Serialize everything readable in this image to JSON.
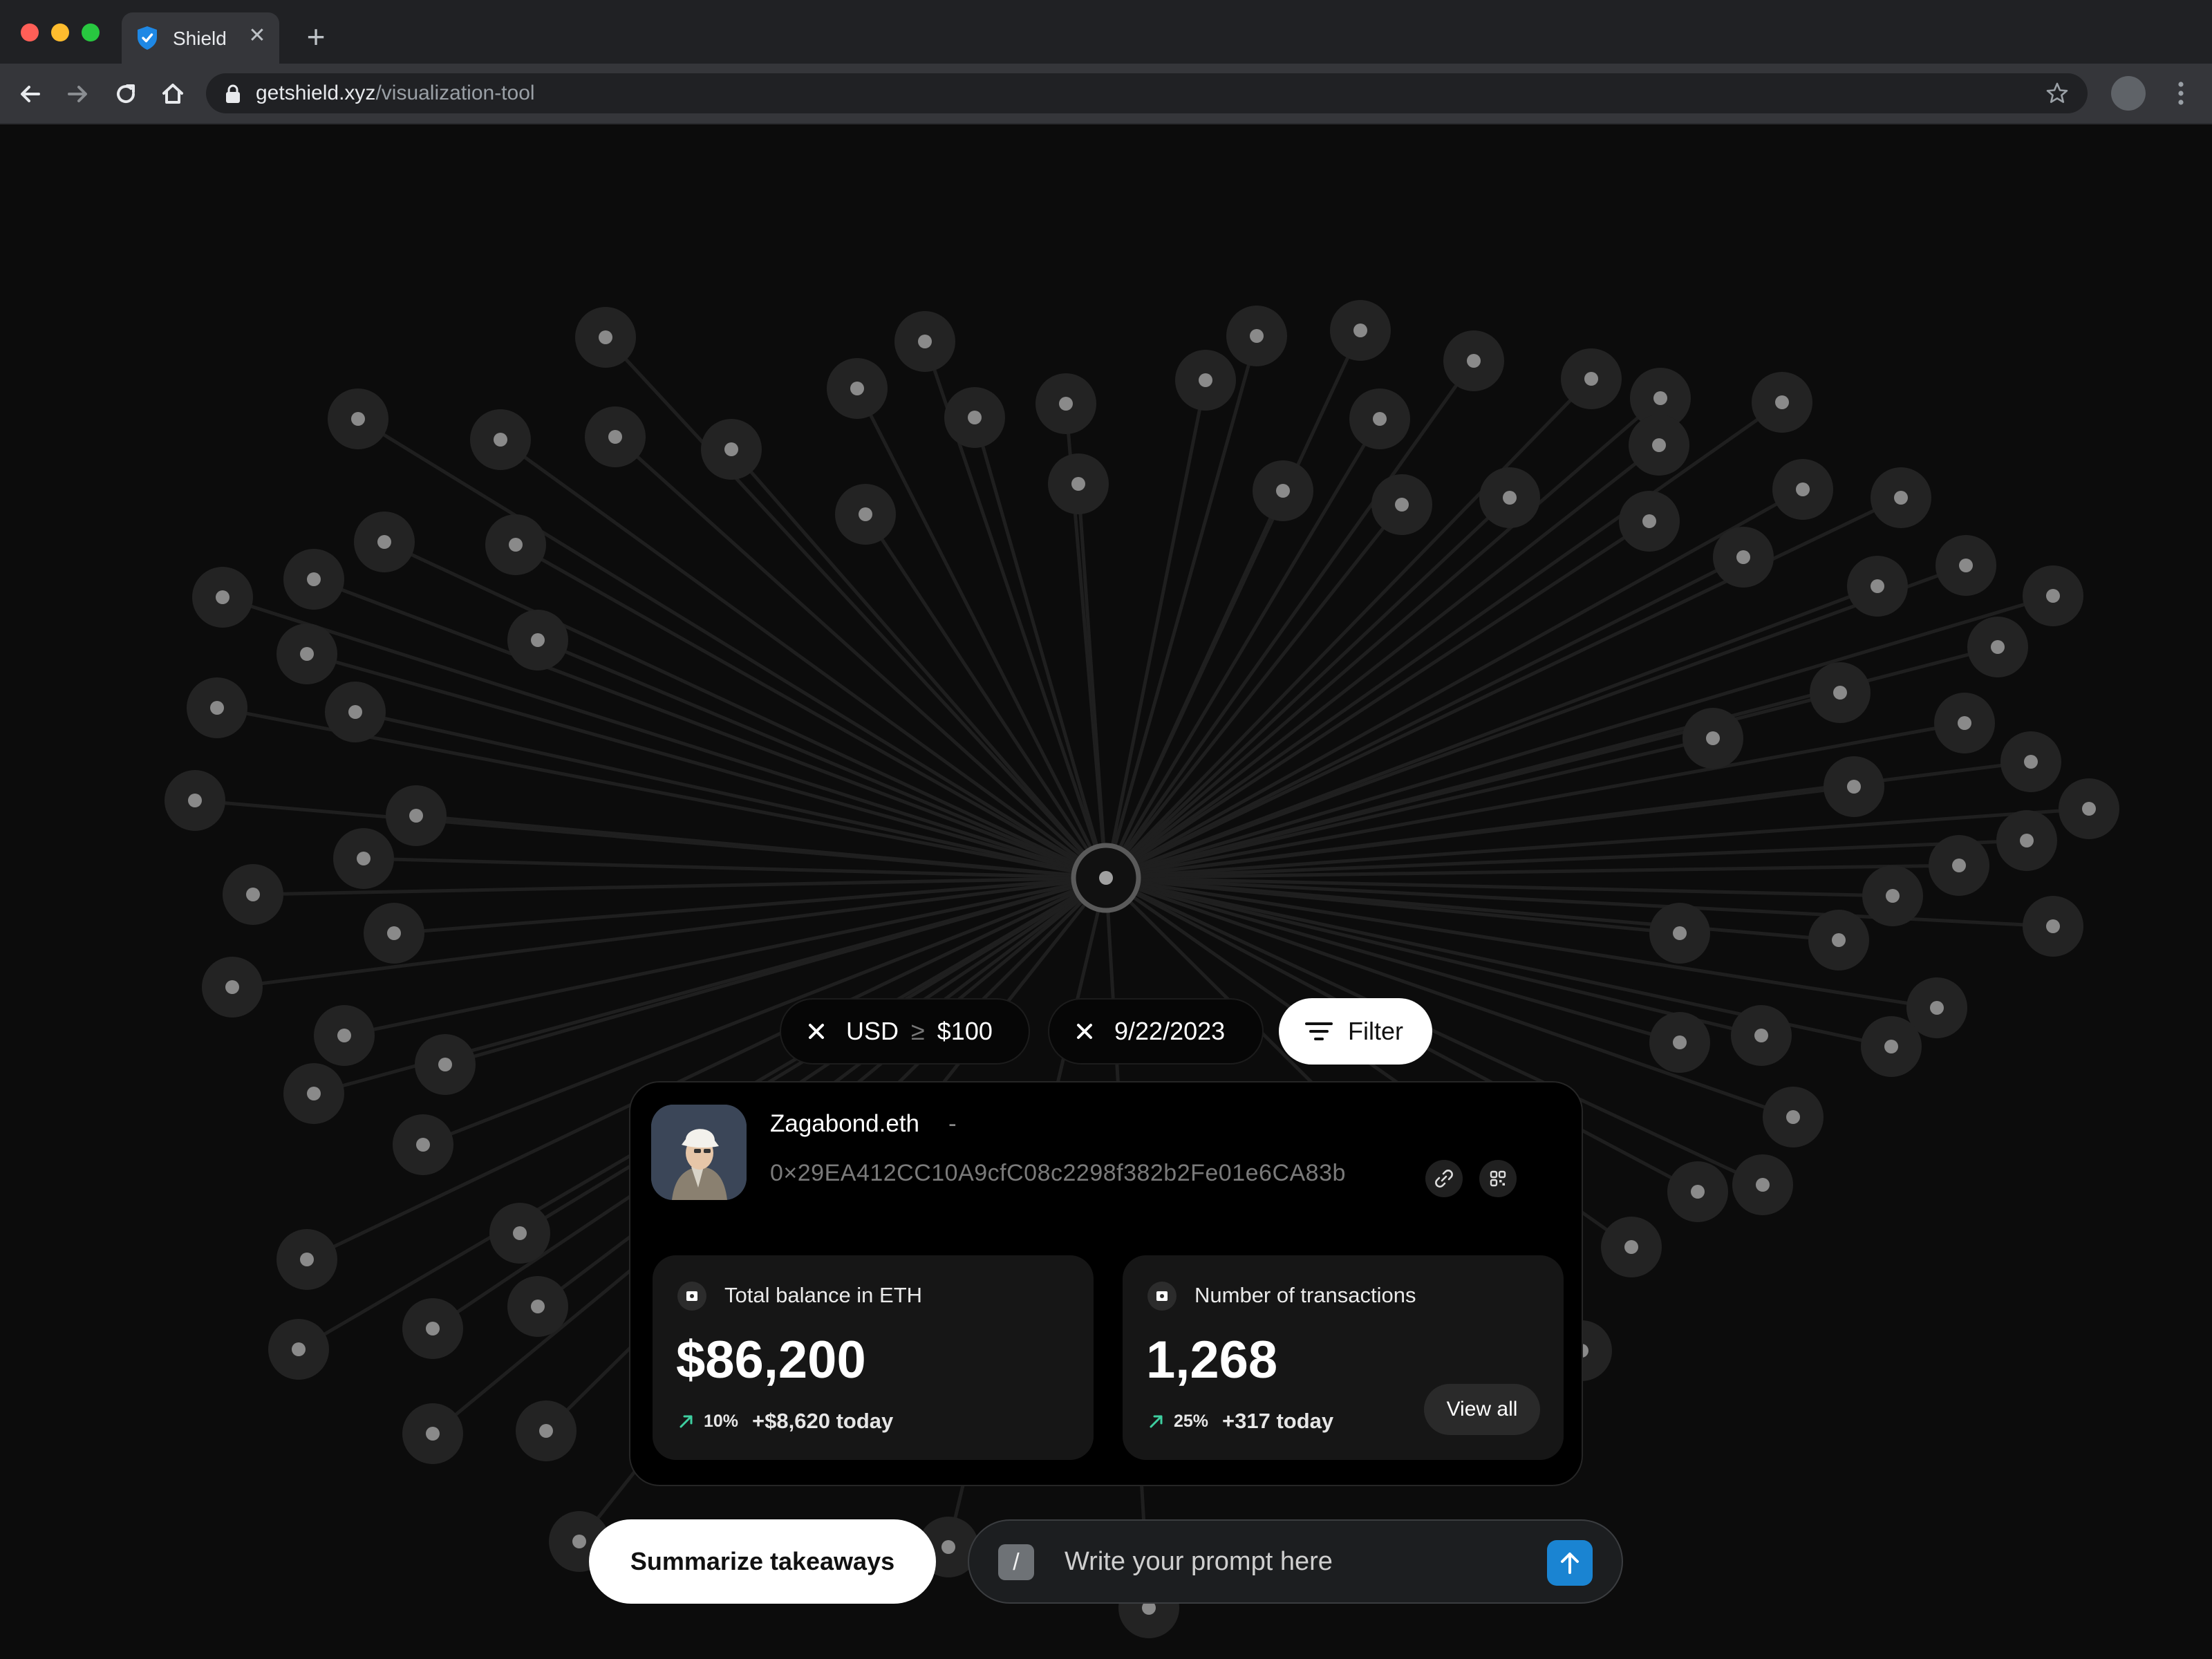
{
  "browser": {
    "tab_title": "Shield",
    "url_domain": "getshield.xyz",
    "url_path": "/visualization-tool",
    "traffic_colors": [
      "#ff5f57",
      "#febc2e",
      "#28c840"
    ],
    "favicon": "shield-icon"
  },
  "filters": {
    "usd_currency": "USD",
    "usd_operator": "≥",
    "usd_value": "$100",
    "date": "9/22/2023",
    "filter_label": "Filter"
  },
  "wallet": {
    "ens_name": "Zagabond.eth",
    "separator": "-",
    "address": "0×29EA412CC10A9cfC08c2298f382b2Fe01e6CA83b",
    "stats": [
      {
        "label": "Total balance in ETH",
        "value": "$86,200",
        "change_pct": "10%",
        "change_today": "+$8,620 today"
      },
      {
        "label": "Number of transactions",
        "value": "1,268",
        "change_pct": "25%",
        "change_today": "+317 today",
        "action_label": "View all"
      }
    ]
  },
  "actions": {
    "summarize_label": "Summarize takeaways",
    "prompt_placeholder": "Write your prompt here",
    "prompt_shortcut": "/"
  },
  "colors": {
    "accent": "#1a84d2",
    "positive": "#3ecfa0",
    "node_fill": "#232323",
    "node_dot": "#8a8a8a"
  }
}
